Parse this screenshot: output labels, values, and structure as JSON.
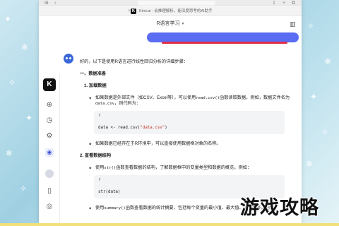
{
  "browser": {
    "address": "",
    "tab_title": "Kimi.ai - 会推理解析，能深度思考的AI助手"
  },
  "chat": {
    "title": "R语言学习",
    "title_chevron": "▾",
    "user_message": ""
  },
  "response": {
    "intro": "好的，以下是使用R语言进行线性回归分析的详细步骤：",
    "section1_title": "一、数据准备",
    "step1_title": "1. 加载数据",
    "step1_bullet1_a": "如果数据是外部文件（如CSV、Excel等），可以使用",
    "step1_bullet1_code1": "read.csv()",
    "step1_bullet1_b": "函数读取数据。例如，数据文件名为",
    "step1_bullet1_code2": "data.csv",
    "step1_bullet1_c": "，则代码为：",
    "code1_lang": "r",
    "code1_pre": "data <- read.csv(",
    "code1_str": "\"data.csv\"",
    "code1_post": ")",
    "step1_bullet2": "如果数据已经存在于R环境中，可以直接使用数据框对象的名称。",
    "step2_title": "2. 查看数据结构",
    "step2_bullet1_a": "使用",
    "step2_bullet1_code": "str()",
    "step2_bullet1_b": "函数查看数据的结构，了解数据框中的变量类型和数据的概览。例如：",
    "code2_lang": "r",
    "code2_line": "str(data)",
    "step2_bullet2_a": "使用",
    "step2_bullet2_code": "summary()",
    "step2_bullet2_b": "函数查看数据的统计摘要，包括每个变量的最小值、最大值、中位数等。例如："
  },
  "overlay": {
    "title": "游戏攻略"
  },
  "colors": {
    "user_bubble": "#5a6cf2",
    "annotation_line": "#e0304a",
    "brand": "#111111",
    "bot_avatar": "#3a68d8"
  },
  "icons": {
    "rail": [
      "kimi-logo",
      "new-chat-icon",
      "history-icon",
      "discover-icon",
      "robot-icon",
      "profile-icon",
      "phone-icon",
      "feedback-icon"
    ],
    "header": [
      "sidebar-toggle-icon",
      "share-icon"
    ]
  }
}
